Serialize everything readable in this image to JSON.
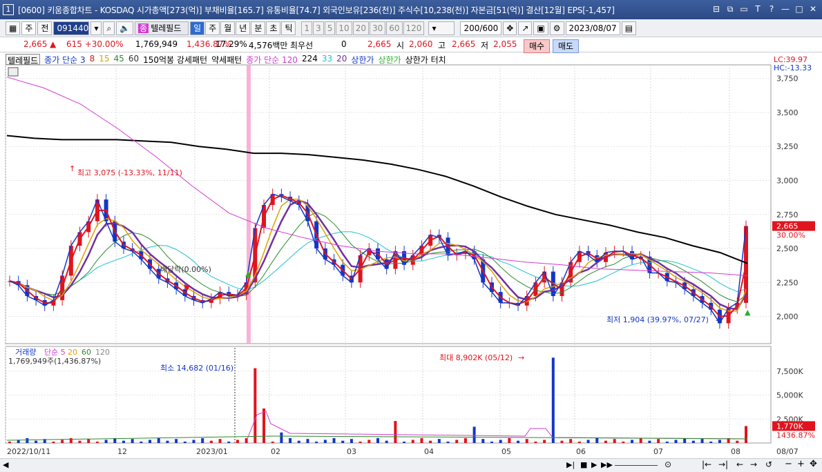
{
  "window": {
    "number": "1",
    "title": "[0600] 키움종합차트 - KOSDAQ 시가총액[273(억)] 부채비율[165.7] 유통비율[74.7] 외국인보유[236(천)] 주식수[10,238(천)] 자본금[51(억)] 결산[12월] EPS[-1,457]",
    "controls": [
      "⊟",
      "⧉",
      "▭",
      "T",
      "?",
      "—",
      "□",
      "✕"
    ]
  },
  "toolbar": {
    "stock_type": "주",
    "prev": "전",
    "code": "091440",
    "indicator_tag": "종",
    "indicator_name": "텔레필드",
    "periods": [
      "일",
      "주",
      "월",
      "년",
      "분",
      "초",
      "틱"
    ],
    "period_active": "일",
    "multipliers": [
      "1",
      "3",
      "5",
      "10",
      "20",
      "30",
      "60",
      "120"
    ],
    "count": "200/600",
    "date": "2023/08/07"
  },
  "price_line": {
    "price": "2,665",
    "change": "615 +30.00%",
    "volume": "1,769,949",
    "volume_ratio": "1,436.87%",
    "turnover": "17.29%",
    "amount": "4,576백만",
    "best_label": "최우선",
    "best_value": "0",
    "close_val": "2,665",
    "open_label": "시",
    "open_val": "2,060",
    "high_label": "고",
    "high_val": "2,665",
    "low_label": "저",
    "low_val": "2,055",
    "buy": "매수",
    "sell": "매도"
  },
  "legend_top": [
    {
      "text": "텔레필드",
      "color": "#000000",
      "box": true
    },
    {
      "text": "종가 단순 3",
      "color": "#1236c8"
    },
    {
      "text": "8",
      "color": "#e0141e"
    },
    {
      "text": "15",
      "color": "#e0a000"
    },
    {
      "text": "45",
      "color": "#2a8a2a"
    },
    {
      "text": "60",
      "color": "#333333"
    },
    {
      "text": "150억봉 강세패턴",
      "color": "#000000"
    },
    {
      "text": "약세패턴",
      "color": "#000000"
    },
    {
      "text": "종가 단순 120",
      "color": "#d23ad2"
    },
    {
      "text": "224",
      "color": "#000000"
    },
    {
      "text": "33",
      "color": "#1fc0d0"
    },
    {
      "text": "20",
      "color": "#7030a0"
    },
    {
      "text": "상한가",
      "color": "#1236c8"
    },
    {
      "text": "상한가",
      "color": "#2ab02a"
    },
    {
      "text": "상한가 터치",
      "color": "#000000"
    }
  ],
  "right_top": {
    "lc": "LC:39.97",
    "hc": "HC:-13.33"
  },
  "price_axis": [
    "3,750",
    "3,500",
    "3,250",
    "3,000",
    "2,750",
    "2,500",
    "2,250",
    "2,000"
  ],
  "price_tag": {
    "price": "2,665",
    "pct": "30.00%"
  },
  "annotations": {
    "high": "최고 3,075 (-13.33%, 11/11)",
    "low": "최저 1,904 (39.97%, 07/27)",
    "dividend": "배당락(0.00%)",
    "vol_min": "최소 14,682 (01/16)",
    "vol_max": "최대 8,902K (05/12)"
  },
  "volume_panel": {
    "legend": [
      {
        "text": "거래량",
        "color": "#1236c8"
      },
      {
        "text": "단순 5",
        "color": "#d23ad2"
      },
      {
        "text": "20",
        "color": "#e0a000"
      },
      {
        "text": "60",
        "color": "#2a8a2a"
      },
      {
        "text": "120",
        "color": "#888888"
      }
    ],
    "current": "1,769,949주(1,436.87%)",
    "axis": [
      "7,500K",
      "5,000K",
      "2,500K"
    ],
    "tag": {
      "value": "1,770K",
      "pct": "1436.87%"
    }
  },
  "date_axis": [
    "2022/10/11",
    "12",
    "2023/01",
    "02",
    "03",
    "04",
    "05",
    "06",
    "07",
    "08",
    "08/07"
  ],
  "colors": {
    "up": "#e0141e",
    "down": "#1236c8",
    "ma120": "#d23ad2",
    "ma224": "#000000",
    "ma33": "#1fc0d0",
    "ma20": "#7030a0",
    "ma15": "#e0a000",
    "ma8": "#e0141e",
    "ma3": "#1236c8"
  },
  "chart_data": {
    "type": "candlestick",
    "title": "텔레필드",
    "ylim": [
      1800,
      3850
    ],
    "x": [
      "2022/10/11",
      "12",
      "2023/01",
      "02",
      "03",
      "04",
      "05",
      "06",
      "07",
      "08"
    ],
    "close_series": [
      2260,
      2230,
      2150,
      2120,
      2080,
      2120,
      2300,
      2520,
      2620,
      2700,
      2860,
      2700,
      2550,
      2500,
      2480,
      2420,
      2350,
      2280,
      2250,
      2200,
      2150,
      2120,
      2100,
      2130,
      2180,
      2150,
      2160,
      2250,
      2650,
      2820,
      2900,
      2880,
      2850,
      2820,
      2700,
      2500,
      2420,
      2380,
      2300,
      2250,
      2450,
      2500,
      2420,
      2350,
      2480,
      2380,
      2450,
      2520,
      2600,
      2580,
      2450,
      2460,
      2480,
      2420,
      2250,
      2180,
      2100,
      2100,
      2080,
      2150,
      2250,
      2330,
      2150,
      2250,
      2400,
      2480,
      2450,
      2400,
      2470,
      2480,
      2480,
      2420,
      2440,
      2320,
      2320,
      2260,
      2250,
      2200,
      2150,
      2100,
      2050,
      1950,
      2060,
      2100,
      2665
    ],
    "ma224": [
      3330,
      3310,
      3300,
      3300,
      3300,
      3290,
      3280,
      3250,
      3230,
      3200,
      3200,
      3190,
      3170,
      3150,
      3120,
      3080,
      3030,
      2960,
      2880,
      2810,
      2750,
      2710,
      2670,
      2620,
      2580,
      2520,
      2470,
      2390
    ],
    "volume_max": 8902,
    "volume_last": 1770
  }
}
